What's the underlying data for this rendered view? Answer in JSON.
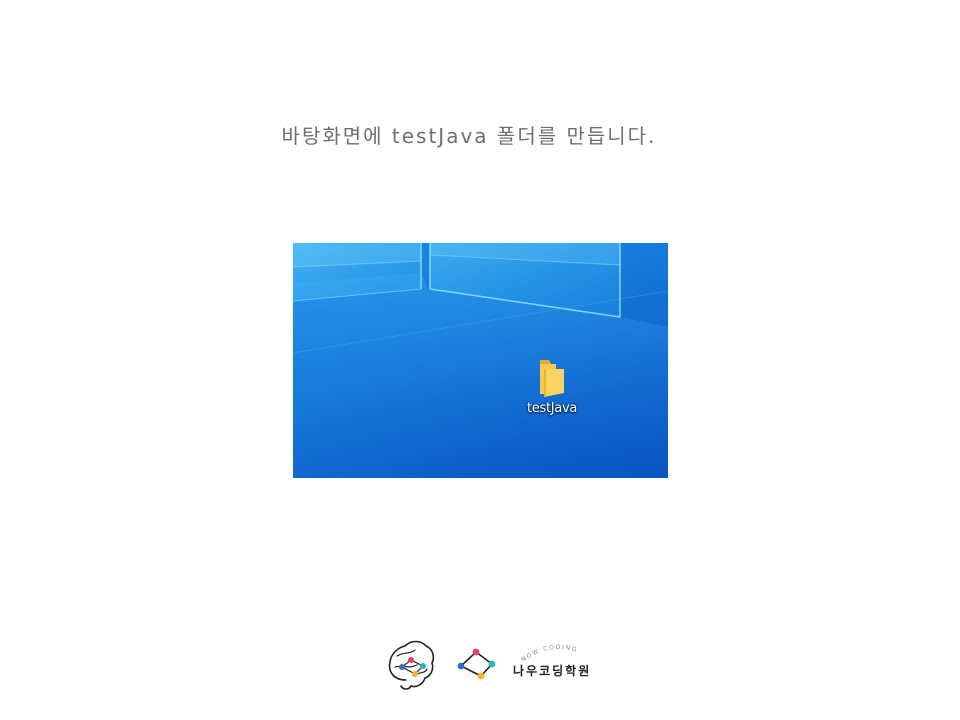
{
  "instruction": {
    "text": "바탕화면에 testJava 폴더를 만듭니다."
  },
  "desktop": {
    "icon": {
      "type": "folder-icon",
      "label": "testJava",
      "color": "#f6c950"
    },
    "background_color": "#1579da"
  },
  "footer": {
    "arc_text": "NOW CODING",
    "academy_name": "나우코딩학원",
    "accent_colors": [
      "#e83e6c",
      "#1fb8c4",
      "#f2b81c",
      "#3a66c9"
    ]
  }
}
